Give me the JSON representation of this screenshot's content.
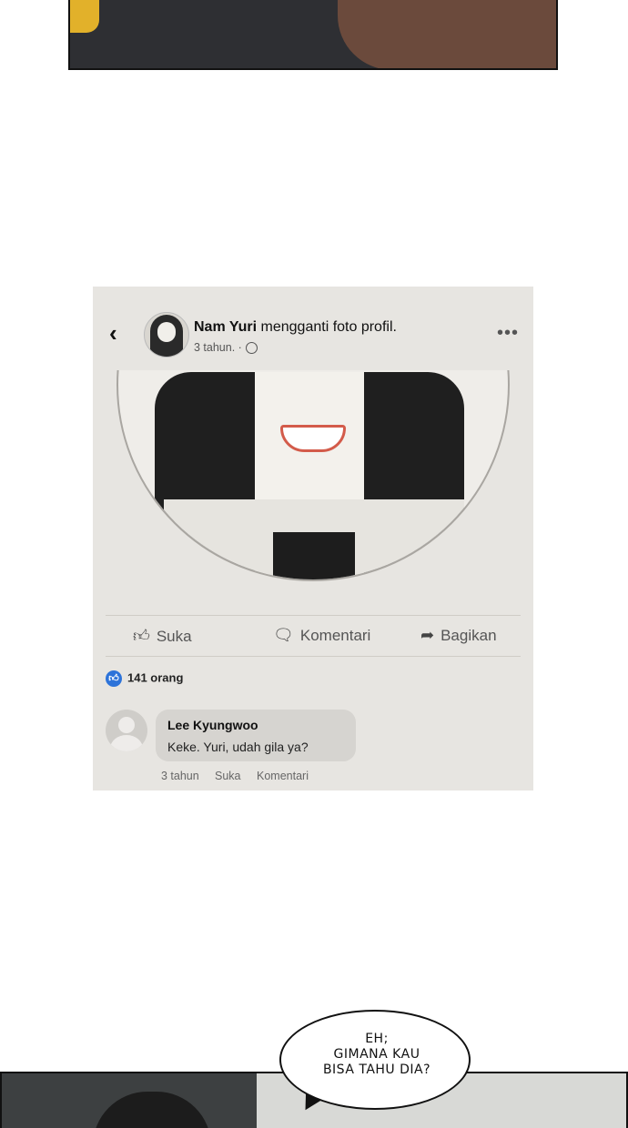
{
  "post": {
    "back_icon": "chevron-left-icon",
    "author": "Nam Yuri",
    "action_text": "mengganti foto profil.",
    "time": "3 tahun. ·",
    "privacy_icon": "globe-icon",
    "more_icon": "more-horizontal-icon"
  },
  "actions": {
    "like_label": "Suka",
    "comment_label": "Komentari",
    "share_label": "Bagikan"
  },
  "reactions": {
    "count_text": "141 orang",
    "icon": "thumbs-up-icon",
    "badge_color": "#2d73d9"
  },
  "comment": {
    "author": "Lee Kyungwoo",
    "text": "Keke. Yuri, udah gila ya?",
    "time": "3 tahun",
    "like_label": "Suka",
    "reply_label": "Komentari"
  },
  "speech": {
    "line1": "EH;",
    "line2": "GIMANA KAU",
    "line3": "BISA TAHU DIA?"
  }
}
